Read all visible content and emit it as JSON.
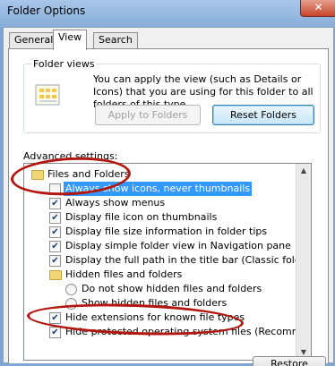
{
  "window": {
    "title": "Folder Options",
    "close_glyph": "✕"
  },
  "tabs": [
    {
      "label": "General"
    },
    {
      "label": "View"
    },
    {
      "label": "Search"
    }
  ],
  "folder_views": {
    "group_label": "Folder views",
    "description": "You can apply the view (such as Details or Icons) that you are using for this folder to all folders of this type.",
    "apply_button": "Apply to Folders",
    "reset_button": "Reset Folders"
  },
  "advanced": {
    "label": "Advanced settings:",
    "items": [
      {
        "kind": "folder",
        "label": "Files and Folders"
      },
      {
        "kind": "checkbox",
        "label": "Always show icons, never thumbnails",
        "checked": false,
        "selected": true
      },
      {
        "kind": "checkbox",
        "label": "Always show menus",
        "checked": true
      },
      {
        "kind": "checkbox",
        "label": "Display file icon on thumbnails",
        "checked": true
      },
      {
        "kind": "checkbox",
        "label": "Display file size information in folder tips",
        "checked": true
      },
      {
        "kind": "checkbox",
        "label": "Display simple folder view in Navigation pane",
        "checked": true
      },
      {
        "kind": "checkbox",
        "label": "Display the full path in the title bar (Classic folders only)",
        "checked": true
      },
      {
        "kind": "folder",
        "label": "Hidden files and folders"
      },
      {
        "kind": "radio",
        "label": "Do not show hidden files and folders"
      },
      {
        "kind": "radio",
        "label": "Show hidden files and folders"
      },
      {
        "kind": "checkbox",
        "label": "Hide extensions for known file types",
        "checked": true
      },
      {
        "kind": "checkbox",
        "label": "Hide protected operating system files (Recommended)",
        "checked": true
      }
    ]
  },
  "check_glyph": "✔",
  "bottom_button": "Restore Defaults",
  "colors": {
    "annotation": "#b2160e",
    "selection": "#3399ff"
  }
}
